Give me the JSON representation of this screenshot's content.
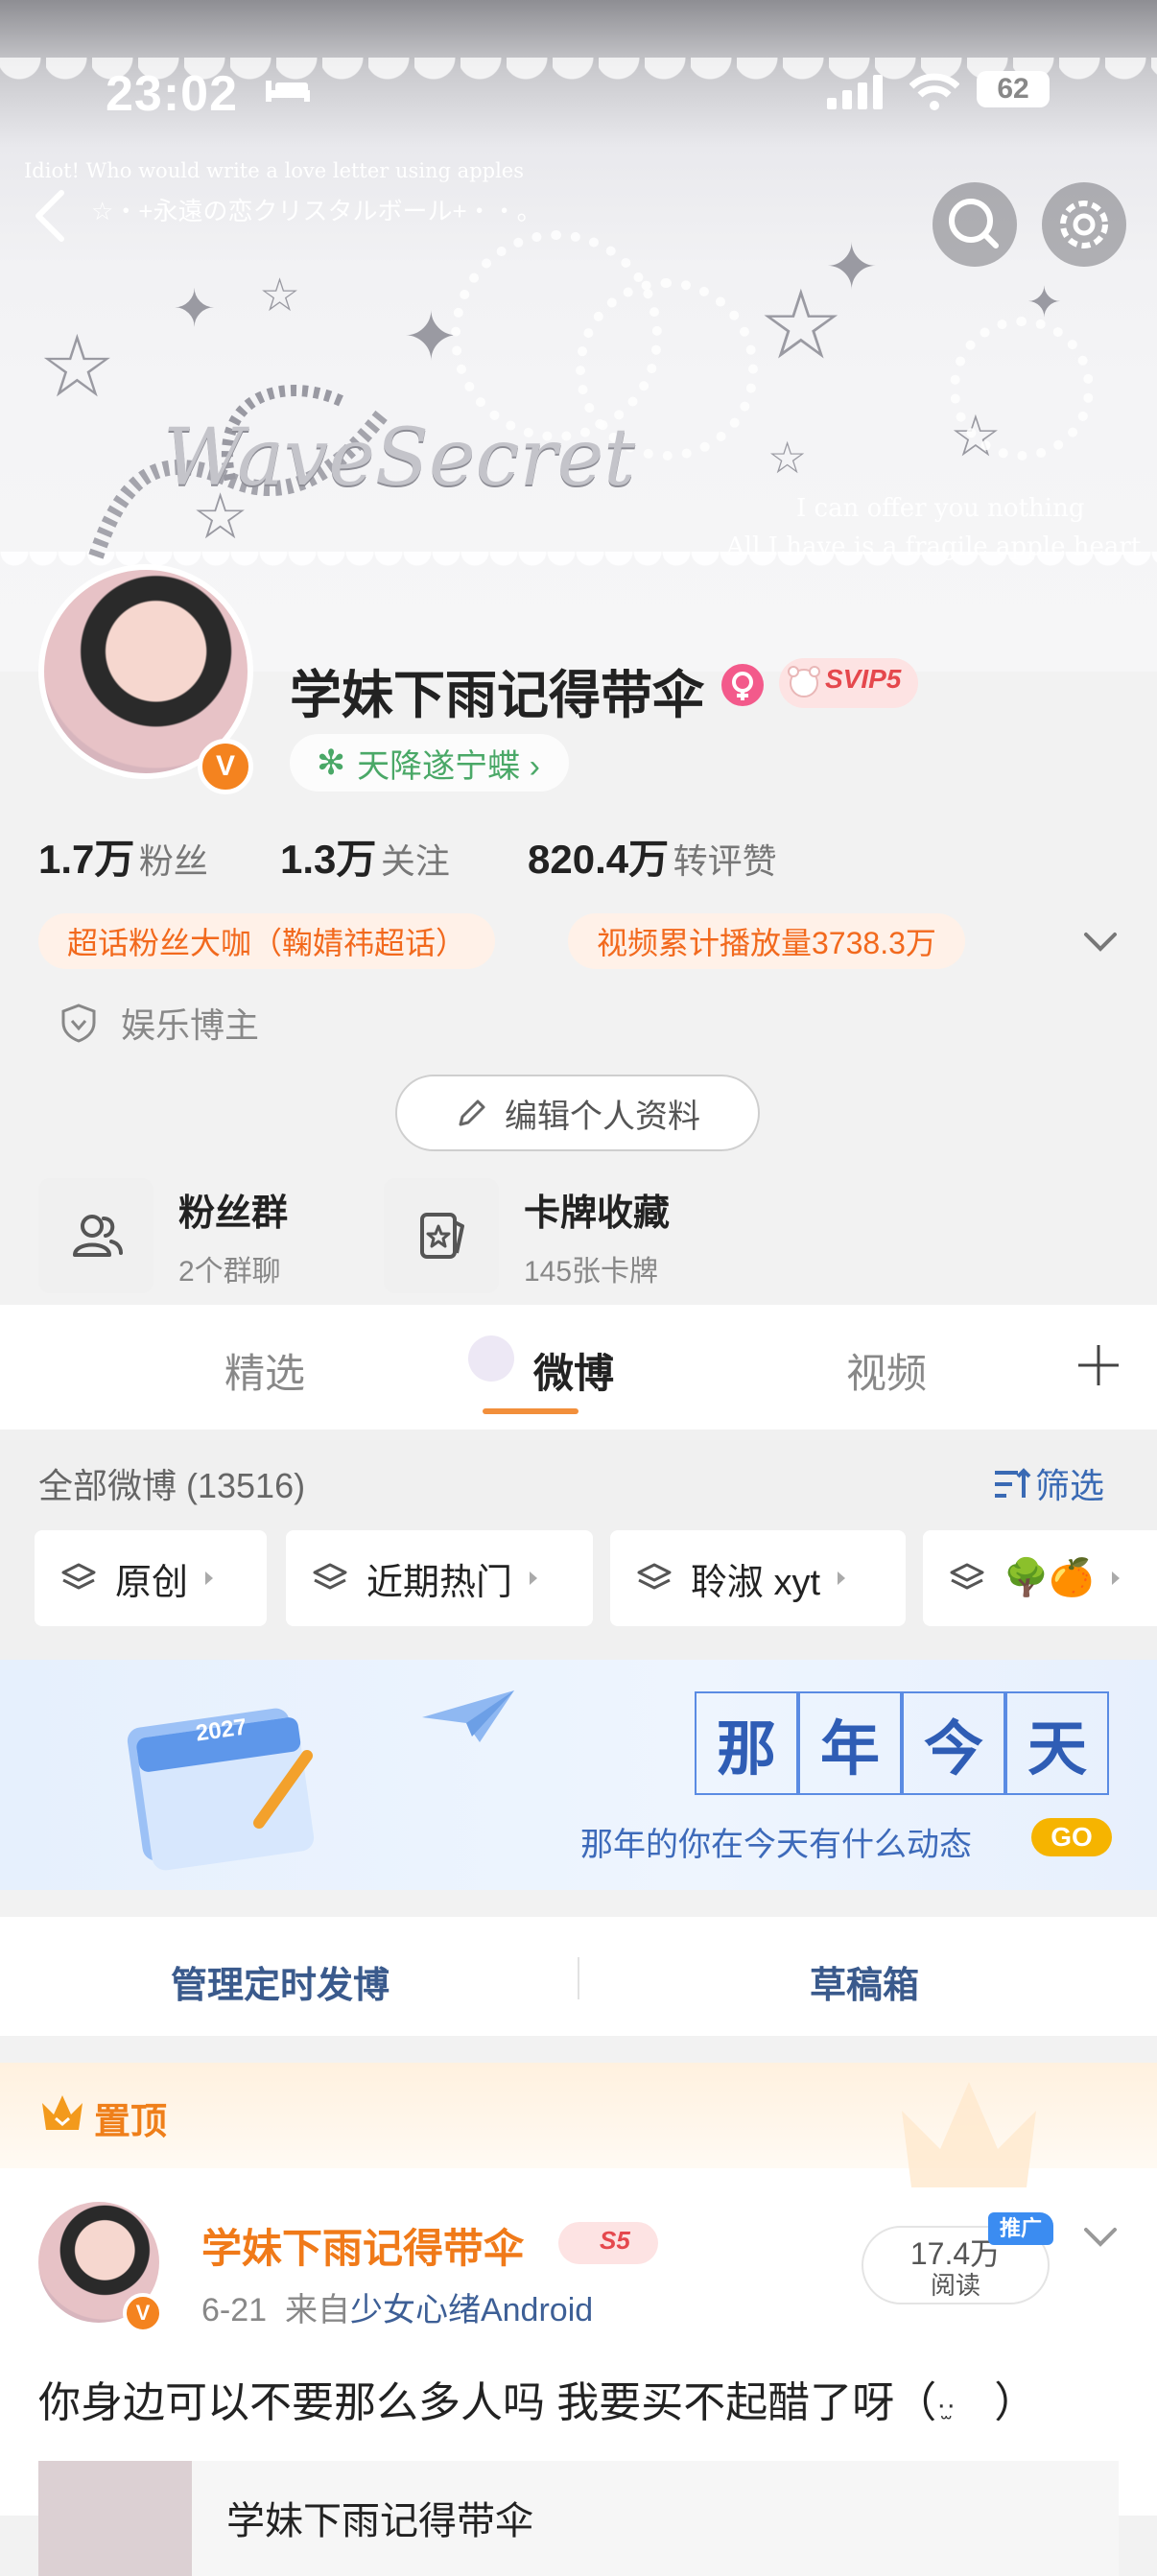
{
  "status_bar": {
    "time": "23:02",
    "battery": "62"
  },
  "header": {
    "caption_small": "Idiot! Who would write a love letter using apples",
    "subtitle": "☆・+永遠の恋クリスタルボール+・・。",
    "brand_script": "WaveSecret",
    "line1": "I can offer you nothing",
    "line2": "All I have is a fragile apple  heart"
  },
  "profile": {
    "name": "学妹下雨记得带伞",
    "vip_label": "SVIP5",
    "ip_location": "天降遂宁蝶 ›",
    "stats": [
      {
        "num": "1.7万",
        "label": "粉丝"
      },
      {
        "num": "1.3万",
        "label": "关注"
      },
      {
        "num": "820.4万",
        "label": "转评赞"
      }
    ],
    "tags": [
      "超话粉丝大咖（鞠婧祎超话）",
      "视频累计播放量3738.3万"
    ],
    "category": "娱乐博主",
    "edit_label": "编辑个人资料"
  },
  "features": [
    {
      "title": "粉丝群",
      "sub": "2个群聊"
    },
    {
      "title": "卡牌收藏",
      "sub": "145张卡牌"
    }
  ],
  "tabs": [
    "精选",
    "微博",
    "视频"
  ],
  "filter": {
    "count_label": "全部微博 (13516)",
    "filter_label": "筛选",
    "chips": [
      "原创",
      "近期热门",
      "聆淑 xyt",
      "🌳🍊"
    ]
  },
  "on_this_day": {
    "chars": [
      "那",
      "年",
      "今",
      "天"
    ],
    "subtitle": "那年的你在今天有什么动态",
    "go": "GO",
    "calendar_year": "2027"
  },
  "management": {
    "scheduled": "管理定时发博",
    "drafts": "草稿箱"
  },
  "pinned_post": {
    "pin_label": "置顶",
    "author": "学妹下雨记得带伞",
    "level": "S5",
    "date": "6-21",
    "from_prefix": "来自",
    "source": "少女心绪Android",
    "reads": "17.4万",
    "reads_label": "阅读",
    "promo": "推广",
    "text": "你身边可以不要那么多人吗 我要买不起醋了呀（",
    "text_tail": "）",
    "retweet_author": "学妹下雨记得带伞"
  },
  "colors": {
    "accent_orange": "#f07a19",
    "link_blue": "#3a6ab4",
    "vip_red": "#e5484d"
  }
}
